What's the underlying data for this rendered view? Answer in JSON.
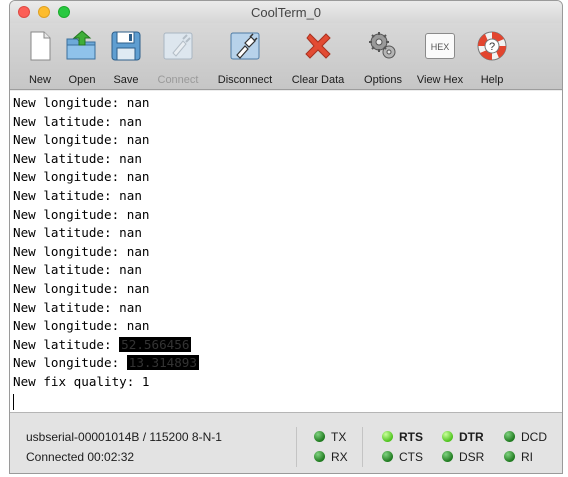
{
  "window": {
    "title": "CoolTerm_0"
  },
  "toolbar": [
    {
      "label": "New",
      "icon": "new-document-icon",
      "enabled": true
    },
    {
      "label": "Open",
      "icon": "open-folder-icon",
      "enabled": true
    },
    {
      "label": "Save",
      "icon": "save-disk-icon",
      "enabled": true
    },
    {
      "label": "Connect",
      "icon": "connect-plug-icon",
      "enabled": false
    },
    {
      "label": "Disconnect",
      "icon": "disconnect-plug-icon",
      "enabled": true
    },
    {
      "label": "Clear Data",
      "icon": "clear-x-icon",
      "enabled": true
    },
    {
      "label": "Options",
      "icon": "gears-icon",
      "enabled": true
    },
    {
      "label": "View Hex",
      "icon": "hex-icon",
      "enabled": true,
      "icon_text": "HEX"
    },
    {
      "label": "Help",
      "icon": "lifebuoy-icon",
      "enabled": true
    }
  ],
  "terminal": {
    "lines": [
      "New longitude: nan",
      "New latitude: nan",
      "New longitude: nan",
      "New latitude: nan",
      "New longitude: nan",
      "New latitude: nan",
      "New longitude: nan",
      "New latitude: nan",
      "New longitude: nan",
      "New latitude: nan",
      "New longitude: nan",
      "New latitude: nan",
      "New longitude: nan"
    ],
    "latitude_prefix": "New latitude: ",
    "latitude_value": "52.566456",
    "longitude_prefix": "New longitude: ",
    "longitude_value": "13.314893",
    "fix_line": "New fix quality: 1"
  },
  "status": {
    "port": "usbserial-00001014B / 115200 8-N-1",
    "connection": "Connected 00:02:32",
    "leds": {
      "tx": "TX",
      "rx": "RX",
      "rts": "RTS",
      "cts": "CTS",
      "dtr": "DTR",
      "dsr": "DSR",
      "dcd": "DCD",
      "ri": "RI"
    }
  }
}
